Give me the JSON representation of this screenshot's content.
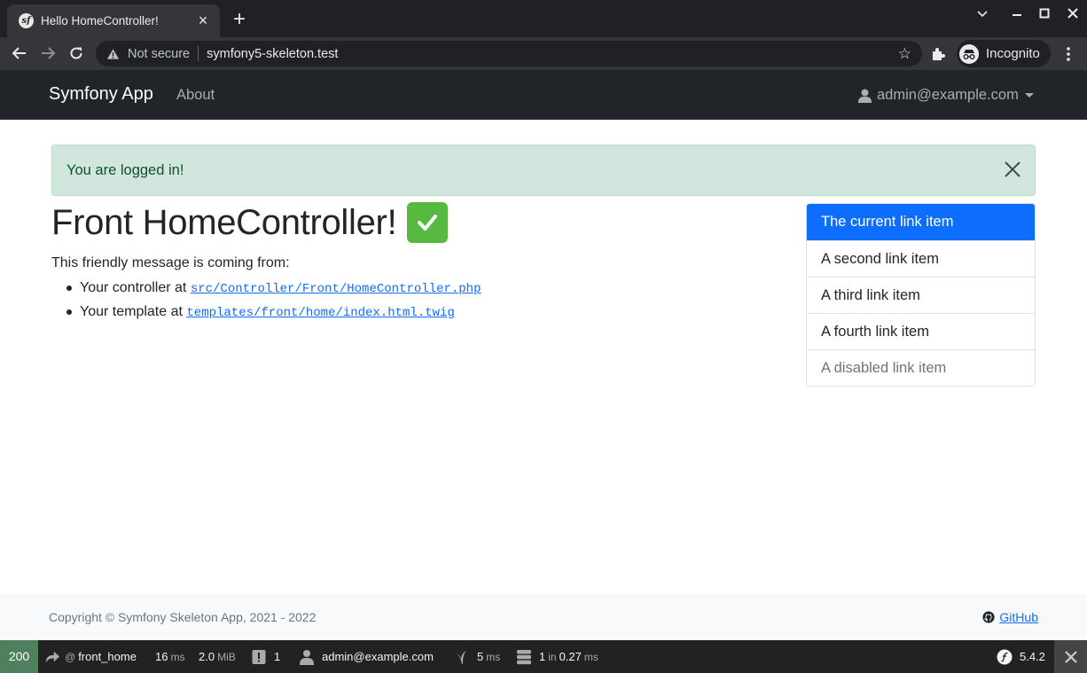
{
  "browser": {
    "tab_title": "Hello HomeController!",
    "favicon_text": "sf",
    "new_tab": "+",
    "not_secure": "Not secure",
    "url": "symfony5-skeleton.test",
    "profile_label": "Incognito"
  },
  "navbar": {
    "brand": "Symfony App",
    "about": "About",
    "user": "admin@example.com"
  },
  "alert": {
    "message": "You are logged in!"
  },
  "main": {
    "heading": "Front HomeController!",
    "intro": "This friendly message is coming from:",
    "items": [
      {
        "prefix": "Your controller at",
        "path": "src/Controller/Front/HomeController.php"
      },
      {
        "prefix": "Your template at",
        "path": "templates/front/home/index.html.twig"
      }
    ]
  },
  "list_group": [
    "The current link item",
    "A second link item",
    "A third link item",
    "A fourth link item",
    "A disabled link item"
  ],
  "footer": {
    "copyright": "Copyright © Symfony Skeleton App, 2021 - 2022",
    "github": "GitHub"
  },
  "debug_toolbar": {
    "status_code": "200",
    "route_at": "@",
    "route": "front_home",
    "time_value": "16",
    "time_unit": "ms",
    "memory_value": "2.0",
    "memory_unit": "MiB",
    "logs_count": "1",
    "user": "admin@example.com",
    "twig_value": "5",
    "twig_unit": "ms",
    "db_queries": "1",
    "db_in": "in",
    "db_time": "0.27",
    "db_unit": "ms",
    "symfony_version": "5.4.2"
  },
  "colors": {
    "primary": "#0d6efd",
    "navbar_bg": "#212529",
    "alert_bg": "#d1e7dd",
    "status_ok": "#4f805d"
  }
}
